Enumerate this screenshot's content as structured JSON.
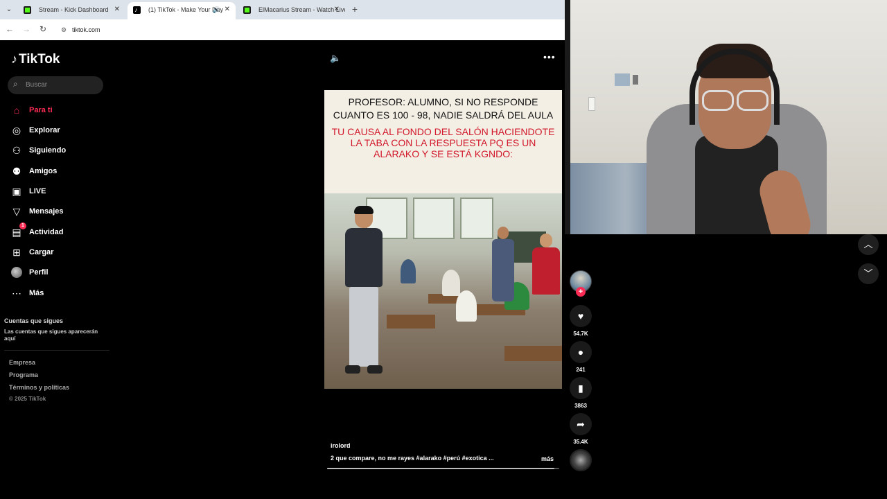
{
  "browser": {
    "tabs": [
      {
        "title": "Stream - Kick Dashboard",
        "favicon": "kick-favicon",
        "active": false
      },
      {
        "title": "(1) TikTok - Make Your Day",
        "favicon": "tiktok-favicon",
        "active": true
      },
      {
        "title": "ElMacarius Stream - Watch Live",
        "favicon": "kick-favicon",
        "active": false
      }
    ],
    "url": "tiktok.com"
  },
  "tiktok": {
    "logo": "TikTok",
    "search_placeholder": "Buscar",
    "nav": [
      {
        "label": "Para ti",
        "icon": "home-icon",
        "active": true
      },
      {
        "label": "Explorar",
        "icon": "compass-icon"
      },
      {
        "label": "Siguiendo",
        "icon": "following-icon"
      },
      {
        "label": "Amigos",
        "icon": "friends-icon"
      },
      {
        "label": "LIVE",
        "icon": "live-icon"
      },
      {
        "label": "Mensajes",
        "icon": "messages-icon"
      },
      {
        "label": "Actividad",
        "icon": "activity-icon",
        "badge": "1"
      },
      {
        "label": "Cargar",
        "icon": "upload-icon"
      },
      {
        "label": "Perfil",
        "icon": "profile-avatar"
      },
      {
        "label": "Más",
        "icon": "more-icon"
      }
    ],
    "following_title": "Cuentas que sigues",
    "following_desc": "Las cuentas que sigues aparecerán aquí",
    "footer": [
      "Empresa",
      "Programa",
      "Términos y políticas"
    ],
    "copyright": "© 2025 TikTok"
  },
  "video": {
    "meme_black": "PROFESOR: ALUMNO, SI NO RESPONDE CUANTO ES 100 - 98, NADIE SALDRÁ DEL AULA",
    "meme_red": "TU CAUSA AL FONDO DEL SALÓN HACIENDOTE LA TABA CON LA RESPUESTA PQ ES UN ALARAKO Y SE ESTÁ KGNDO:",
    "author": "irolord",
    "caption": "2 que compare, no me rayes #alarako  #perú  #exotica  ...",
    "more_label": "más",
    "progress": 0.98
  },
  "actions": {
    "likes": "54.7K",
    "comments": "241",
    "saves": "3863",
    "shares": "35.4K"
  }
}
